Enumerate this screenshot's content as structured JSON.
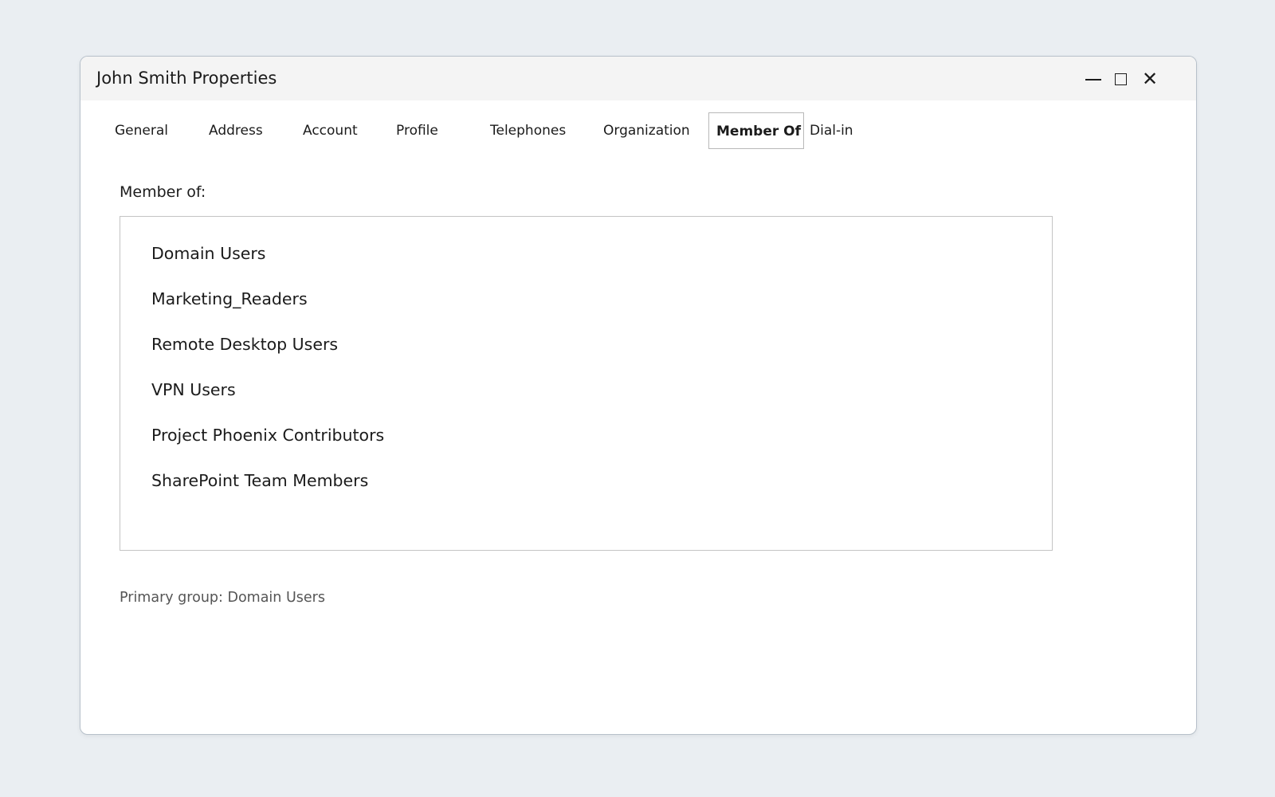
{
  "window": {
    "title": "John Smith Properties",
    "controls": {
      "minimize_icon": "minimize-icon",
      "maximize_icon": "maximize-icon",
      "close_icon": "close-icon",
      "close_glyph": "✕"
    }
  },
  "tabs": [
    {
      "label": "General"
    },
    {
      "label": "Address"
    },
    {
      "label": "Account"
    },
    {
      "label": "Profile"
    },
    {
      "label": "Telephones"
    },
    {
      "label": "Organization"
    },
    {
      "label": "Member Of",
      "active": true
    },
    {
      "label": "Dial-in"
    }
  ],
  "member_of": {
    "label": "Member of:",
    "items": [
      "Domain Users",
      "Marketing_Readers",
      "Remote Desktop Users",
      "VPN Users",
      "Project Phoenix Contributors",
      "SharePoint Team Members"
    ]
  },
  "primary_group": {
    "text": "Primary group: Domain Users"
  },
  "colors": {
    "background": "#eaeef2",
    "titlebar": "#f4f4f4",
    "text": "#1b1b1b",
    "muted_text": "#555555"
  }
}
